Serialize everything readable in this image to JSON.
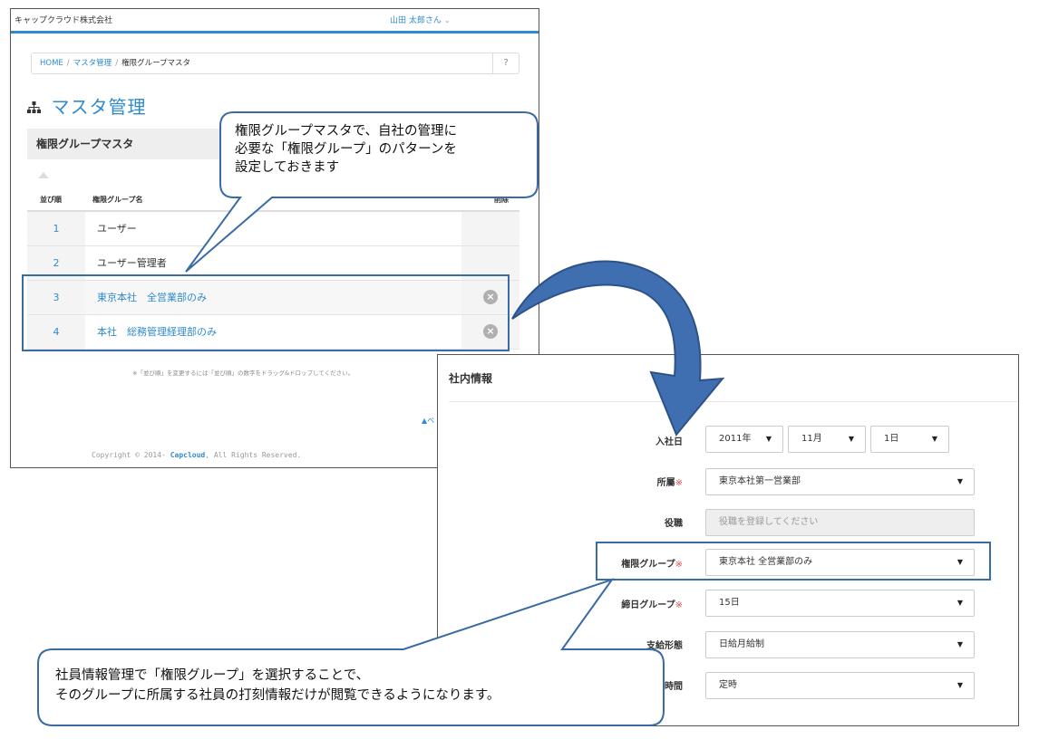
{
  "shot1": {
    "company": "キャップクラウド株式会社",
    "user": "山田 太郎さん",
    "user_caret": "⌄",
    "breadcrumb": {
      "home": "HOME",
      "sep": "/",
      "master": "マスタ管理",
      "current": "権限グループマスタ",
      "help": "?"
    },
    "page_title_icon": "sitemap-icon",
    "page_title": "マスタ管理",
    "panel_title": "権限グループマスタ",
    "table": {
      "headers": [
        "並び順",
        "権限グループ名",
        "削除"
      ],
      "rows": [
        {
          "num": "1",
          "name": "ユーザー"
        },
        {
          "num": "2",
          "name": "ユーザー管理者"
        },
        {
          "num": "3",
          "name": "東京本社　全営業部のみ",
          "delete_icon": "close-circle-icon"
        },
        {
          "num": "4",
          "name": "本社　総務管理経理部のみ",
          "delete_icon": "close-circle-icon"
        }
      ]
    },
    "note": "※「並び順」を変更するには「並び順」の数字をドラッグ&ドロップしてください。",
    "pagetop": "▲ペ",
    "copyright_prefix": "Copyright © 2014- ",
    "copyright_brand": "Capcloud",
    "copyright_suffix": ", All Rights Reserved."
  },
  "shot2": {
    "section_title": "社内情報",
    "fields": {
      "join_date": {
        "label": "入社日",
        "year": "2011年",
        "month": "11月",
        "day": "1日"
      },
      "dept": {
        "label": "所屬",
        "req": "※",
        "value": "東京本社第一営業部"
      },
      "role": {
        "label": "役職",
        "placeholder": "役職を登録してください"
      },
      "auth_group": {
        "label": "権限グループ",
        "req": "※",
        "value": "東京本社 全営業部のみ"
      },
      "closing_group": {
        "label": "締日グループ",
        "req": "※",
        "value": "15日"
      },
      "payment": {
        "label": "支給形態",
        "value": "日給月給制"
      },
      "hours": {
        "label": "時間",
        "value": "定時"
      }
    },
    "arrow": "▼"
  },
  "callouts": {
    "top": [
      "権限グループマスタで、自社の管理に",
      "必要な「権限グループ」のパターンを",
      "設定しておきます"
    ],
    "bottom": [
      "社員情報管理で「権限グループ」を選択することで、",
      "そのグループに所属する社員の打刻情報だけが閲覧できるようになります。"
    ]
  },
  "colors": {
    "accent": "#2e8bd0",
    "callout_border": "#3a6ba6",
    "arrow_fill": "#3f6fb1",
    "required": "#d9534f"
  }
}
